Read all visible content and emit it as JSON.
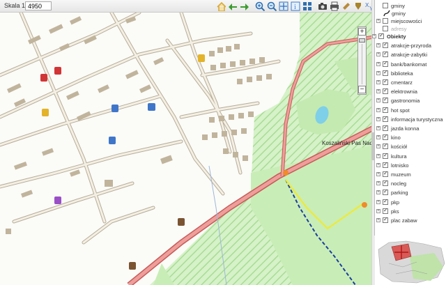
{
  "toolbar": {
    "scale_label": "Skala 1:",
    "scale_value": "4950",
    "tools": [
      {
        "icon": "home-icon",
        "color": "#d9a93a"
      },
      {
        "icon": "back-icon",
        "color": "#3b9b2f"
      },
      {
        "icon": "forward-icon",
        "color": "#3b9b2f"
      },
      {
        "icon": "zoom-in-icon",
        "color": "#2e6fb0"
      },
      {
        "icon": "zoom-out-icon",
        "color": "#2e6fb0"
      },
      {
        "icon": "pan-icon",
        "color": "#3d6fb2"
      },
      {
        "icon": "info-icon",
        "color": "#3c7cc7"
      },
      {
        "icon": "layers-grid-icon",
        "color": "#2e6fb0"
      },
      {
        "icon": "camera-icon",
        "color": "#444444"
      },
      {
        "icon": "print-icon",
        "color": "#555555"
      },
      {
        "icon": "measure-icon",
        "color": "#b88b3a"
      },
      {
        "icon": "area-icon",
        "color": "#a8842a"
      },
      {
        "icon": "coordinates-icon",
        "color": "#3a6ec0"
      },
      {
        "icon": "pencil-icon",
        "color": "#c93a3a"
      },
      {
        "icon": "refresh-icon",
        "color": "#2e7fcf"
      }
    ]
  },
  "map": {
    "label_place": "Koszaliński Pas Nadmo",
    "colors": {
      "buildings": "#c1b49c",
      "roads": "#e3dccd",
      "road_edge": "#9c8f78",
      "main_road": "#e07f7d",
      "forest": "#c7ecb5",
      "forest_hatch": "#9fd58b",
      "water": "#7ecfe8",
      "trail_blue": "#1a3fa0",
      "trail_yellow": "#f2ea2a"
    }
  },
  "zoom": {
    "plus": "+",
    "minus": "−"
  },
  "layers": {
    "items": [
      {
        "label": "gminy",
        "type": "cb",
        "indent": 1,
        "checked": false,
        "expander": false
      },
      {
        "label": "gminy",
        "type": "legend",
        "indent": 2,
        "checked": false,
        "expander": false
      },
      {
        "label": "miejscowości",
        "type": "cb",
        "indent": 1,
        "checked": false,
        "expander": true
      },
      {
        "label": "adresy",
        "type": "cb",
        "indent": 1,
        "checked": false,
        "expander": false,
        "grey": true
      },
      {
        "label": "Obiekty",
        "type": "cb",
        "indent": 0,
        "checked": true,
        "expander": true,
        "bold": true
      },
      {
        "label": "atrakcje-przyroda",
        "type": "cb",
        "indent": 1,
        "checked": true,
        "expander": true
      },
      {
        "label": "atrakcje-zabytki",
        "type": "cb",
        "indent": 1,
        "checked": true,
        "expander": true
      },
      {
        "label": "bank/bankomat",
        "type": "cb",
        "indent": 1,
        "checked": true,
        "expander": true
      },
      {
        "label": "biblioteka",
        "type": "cb",
        "indent": 1,
        "checked": true,
        "expander": true
      },
      {
        "label": "cmentarz",
        "type": "cb",
        "indent": 1,
        "checked": true,
        "expander": true
      },
      {
        "label": "elektrownia",
        "type": "cb",
        "indent": 1,
        "checked": true,
        "expander": true
      },
      {
        "label": "gastronomia",
        "type": "cb",
        "indent": 1,
        "checked": true,
        "expander": true
      },
      {
        "label": "hot spot",
        "type": "cb",
        "indent": 1,
        "checked": true,
        "expander": true
      },
      {
        "label": "informacja turystyczna",
        "type": "cb",
        "indent": 1,
        "checked": true,
        "expander": true
      },
      {
        "label": "jazda konna",
        "type": "cb",
        "indent": 1,
        "checked": true,
        "expander": true
      },
      {
        "label": "kino",
        "type": "cb",
        "indent": 1,
        "checked": true,
        "expander": true
      },
      {
        "label": "kościół",
        "type": "cb",
        "indent": 1,
        "checked": true,
        "expander": true
      },
      {
        "label": "kultura",
        "type": "cb",
        "indent": 1,
        "checked": true,
        "expander": true
      },
      {
        "label": "lotnisko",
        "type": "cb",
        "indent": 1,
        "checked": true,
        "expander": true
      },
      {
        "label": "muzeum",
        "type": "cb",
        "indent": 1,
        "checked": true,
        "expander": true
      },
      {
        "label": "nocleg",
        "type": "cb",
        "indent": 1,
        "checked": true,
        "expander": true
      },
      {
        "label": "parking",
        "type": "cb",
        "indent": 1,
        "checked": true,
        "expander": true
      },
      {
        "label": "pkp",
        "type": "cb",
        "indent": 1,
        "checked": true,
        "expander": true
      },
      {
        "label": "pks",
        "type": "cb",
        "indent": 1,
        "checked": true,
        "expander": true
      },
      {
        "label": "plac zabaw",
        "type": "cb",
        "indent": 1,
        "checked": true,
        "expander": true
      }
    ]
  }
}
